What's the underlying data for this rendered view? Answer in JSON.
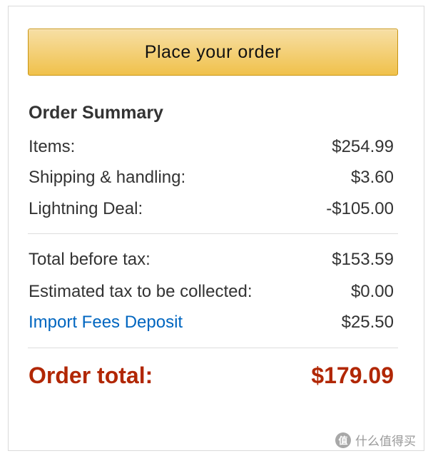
{
  "order_button": {
    "label": "Place your order"
  },
  "summary": {
    "title": "Order Summary",
    "rows": [
      {
        "label": "Items:",
        "value": "$254.99"
      },
      {
        "label": "Shipping & handling:",
        "value": "$3.60"
      },
      {
        "label": "Lightning Deal:",
        "value": "-$105.00"
      }
    ],
    "tax_rows": [
      {
        "label": "Total before tax:",
        "value": "$153.59"
      },
      {
        "label": "Estimated tax to be collected:",
        "value": "$0.00"
      },
      {
        "label": "Import Fees Deposit",
        "value": "$25.50"
      }
    ],
    "total": {
      "label": "Order total:",
      "value": "$179.09"
    }
  },
  "watermark": {
    "icon_glyph": "值",
    "text": "什么值得买"
  },
  "colors": {
    "button_gradient_top": "#f7dfa5",
    "button_gradient_bottom": "#f0c14b",
    "total_red": "#b12704",
    "link_blue": "#0066c0"
  }
}
